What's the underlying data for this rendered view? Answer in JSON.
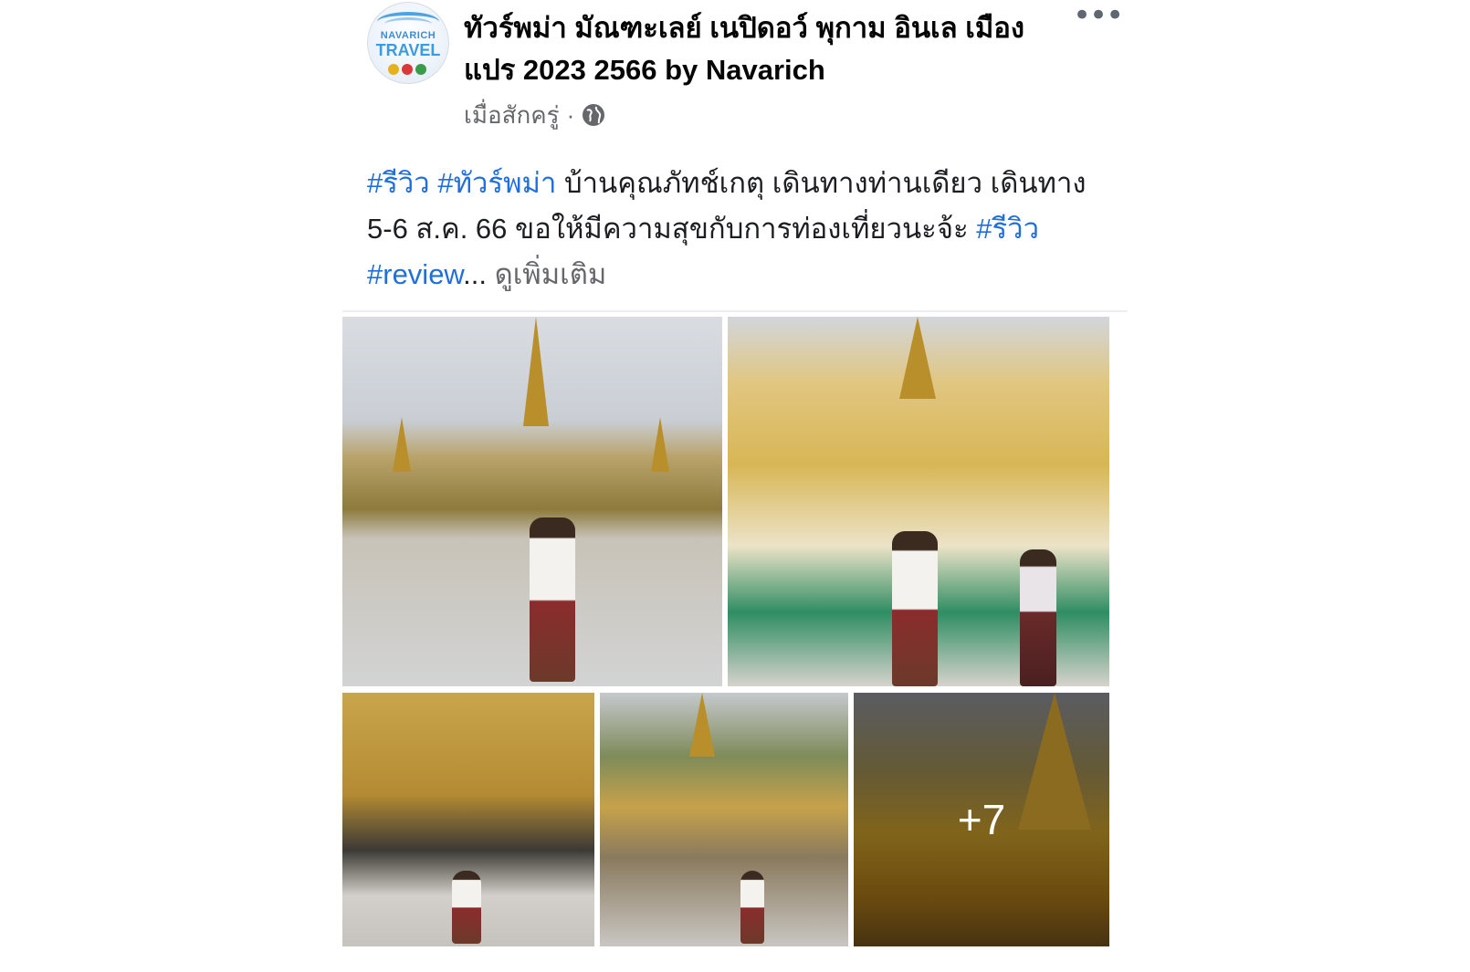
{
  "post": {
    "page_name": "ทัวร์พม่า มัณฑะเลย์ เนปิดอว์ พุกาม อินเล เมืองแปร 2023 2566 by Navarich",
    "avatar_text_line1": "NAVARICH",
    "avatar_text_line2": "TRAVEL",
    "more_label": "•••",
    "timestamp": "เมื่อสักครู่",
    "separator": "·",
    "audience_icon": "globe-icon",
    "caption": {
      "tag1": "#รีวิว",
      "tag2": "#ทัวร์พม่า",
      "text1": " บ้านคุณภัทช์เกตุ เดินทางท่านเดียว เดินทาง 5-6 ส.ค. 66 ขอให้มีความสุขกับการท่องเที่ยวนะจ้ะ ",
      "tag3": "#รีวิว",
      "tag4": "#review",
      "ellipsis": "...",
      "see_more": " ดูเพิ่มเติม"
    },
    "photos": {
      "more_count": "+7"
    }
  },
  "colors": {
    "text": "#050505",
    "secondary": "#65676b",
    "link": "#216fdb"
  }
}
